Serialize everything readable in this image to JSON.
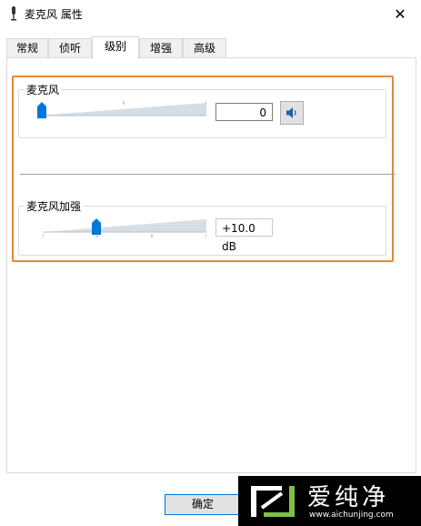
{
  "window": {
    "title": "麦克风 属性",
    "close_symbol": "✕"
  },
  "tabs": [
    {
      "label": "常规"
    },
    {
      "label": "侦听"
    },
    {
      "label": "级别"
    },
    {
      "label": "增强"
    },
    {
      "label": "高级"
    }
  ],
  "active_tab": "级别",
  "levels": {
    "microphone": {
      "label": "麦克风",
      "value": "0",
      "slider_fraction": 0.0,
      "mute_icon": "speaker-icon"
    },
    "boost": {
      "label": "麦克风加强",
      "value": "+10.0 dB",
      "slider_fraction": 0.33
    }
  },
  "footer": {
    "ok_label": "确定"
  },
  "watermark": {
    "text": "爱纯净",
    "url": "www.aichunjing.com"
  },
  "colors": {
    "accent": "#0078d7",
    "highlight_border": "#e08a3c"
  }
}
